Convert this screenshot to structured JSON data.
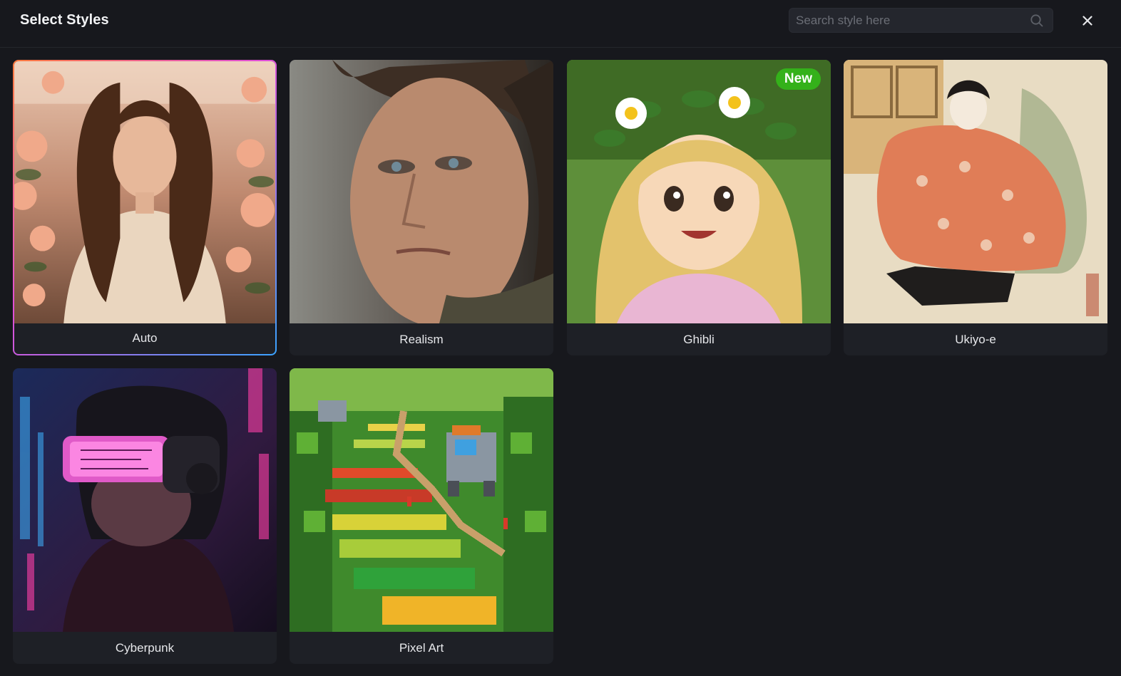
{
  "header": {
    "title": "Select Styles",
    "search_placeholder": "Search style here",
    "search_value": "",
    "close_icon": "close-icon",
    "search_icon": "search-icon"
  },
  "styles": [
    {
      "label": "Auto",
      "selected": true,
      "badge": ""
    },
    {
      "label": "Realism",
      "selected": false,
      "badge": ""
    },
    {
      "label": "Ghibli",
      "selected": false,
      "badge": "New"
    },
    {
      "label": "Ukiyo-e",
      "selected": false,
      "badge": ""
    },
    {
      "label": "Cyberpunk",
      "selected": false,
      "badge": ""
    },
    {
      "label": "Pixel Art",
      "selected": false,
      "badge": ""
    }
  ],
  "colors": {
    "background": "#17181d",
    "card": "#1e2026",
    "badge": "#34b11a",
    "selected_gradient": [
      "#ff7a3d",
      "#e04fd8",
      "#3aa3ff"
    ]
  }
}
